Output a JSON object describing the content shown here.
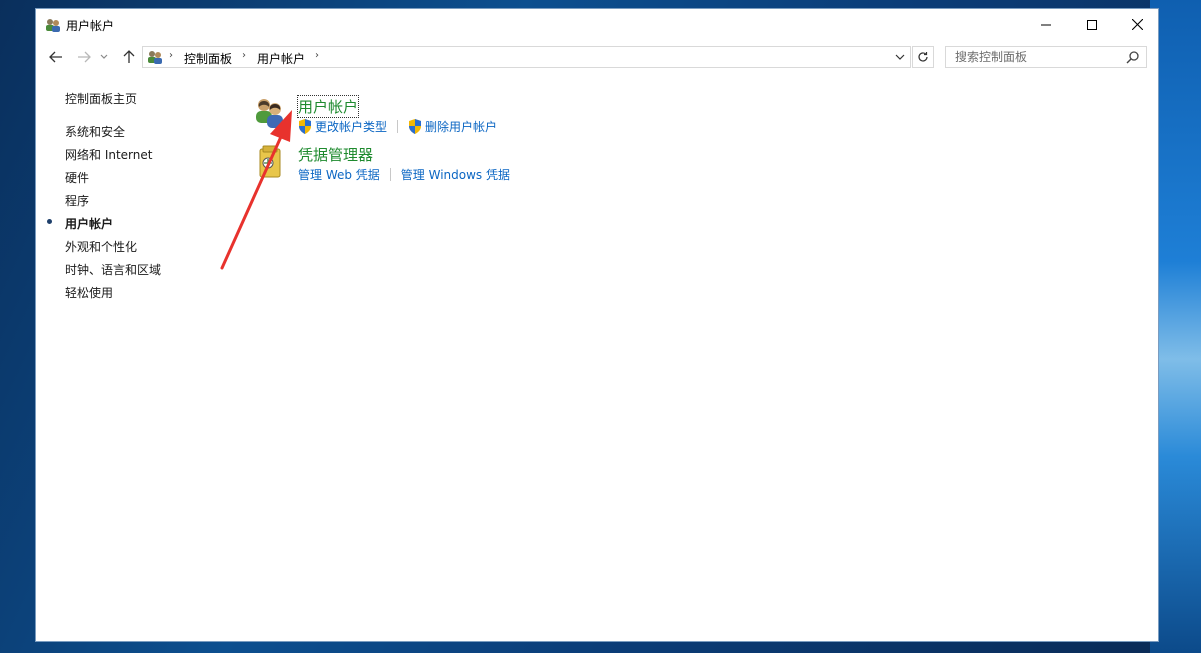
{
  "window": {
    "title": "用户帐户",
    "icon": "user-accounts-icon",
    "controls": {
      "minimize": "minimize-icon",
      "maximize": "maximize-icon",
      "close": "close-icon"
    }
  },
  "addressbar": {
    "breadcrumbs": [
      "控制面板",
      "用户帐户"
    ],
    "search_placeholder": "搜索控制面板"
  },
  "sidebar": {
    "home": "控制面板主页",
    "items": [
      {
        "label": "系统和安全",
        "active": false
      },
      {
        "label": "网络和 Internet",
        "active": false
      },
      {
        "label": "硬件",
        "active": false
      },
      {
        "label": "程序",
        "active": false
      },
      {
        "label": "用户帐户",
        "active": true
      },
      {
        "label": "外观和个性化",
        "active": false
      },
      {
        "label": "时钟、语言和区域",
        "active": false
      },
      {
        "label": "轻松使用",
        "active": false
      }
    ]
  },
  "categories": [
    {
      "title": "用户帐户",
      "icon": "user-accounts-icon",
      "links": [
        {
          "label": "更改帐户类型",
          "icon": "uac-shield-icon"
        },
        {
          "label": "删除用户帐户",
          "icon": "uac-shield-icon"
        }
      ]
    },
    {
      "title": "凭据管理器",
      "icon": "credential-manager-icon",
      "links": [
        {
          "label": "管理 Web 凭据"
        },
        {
          "label": "管理 Windows 凭据"
        }
      ]
    }
  ],
  "annotation": {
    "type": "red-arrow",
    "color": "#e8322d"
  },
  "colors": {
    "category_title": "#1e8a2e",
    "link": "#0b66c3",
    "desktop": "#0d4f8f"
  }
}
